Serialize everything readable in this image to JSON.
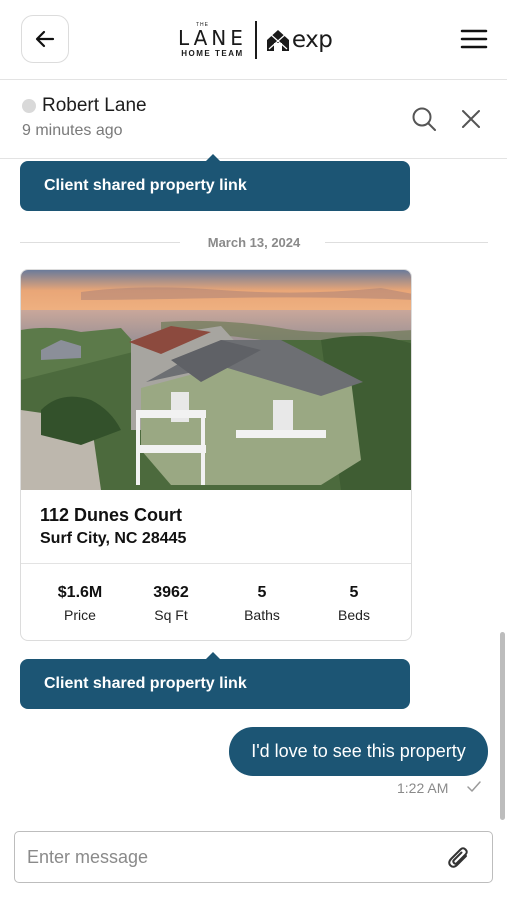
{
  "header": {
    "back_icon": "arrow-left-icon",
    "logo": {
      "the": "THE",
      "lane": "LANE",
      "subtitle": "HOME TEAM",
      "brand": "exp"
    },
    "menu_icon": "hamburger-menu-icon"
  },
  "chat": {
    "contact_name": "Robert Lane",
    "last_seen": "9 minutes ago",
    "search_icon": "search-icon",
    "close_icon": "close-icon"
  },
  "messages": {
    "notice_top": "Client shared property link",
    "date_separator": "March 13, 2024",
    "property": {
      "street": "112 Dunes Court",
      "city": "Surf City, NC 28445",
      "stats": [
        {
          "value": "$1.6M",
          "label": "Price"
        },
        {
          "value": "3962",
          "label": "Sq Ft"
        },
        {
          "value": "5",
          "label": "Baths"
        },
        {
          "value": "5",
          "label": "Beds"
        }
      ]
    },
    "notice_bottom": "Client shared property link",
    "outgoing": {
      "text": "I'd love to see this property",
      "time": "1:22 AM",
      "status_icon": "check-icon"
    }
  },
  "composer": {
    "placeholder": "Enter message",
    "attach_icon": "paperclip-icon"
  },
  "colors": {
    "accent": "#1c5574",
    "border": "#dcdcdc",
    "muted": "#8a8a8a"
  }
}
